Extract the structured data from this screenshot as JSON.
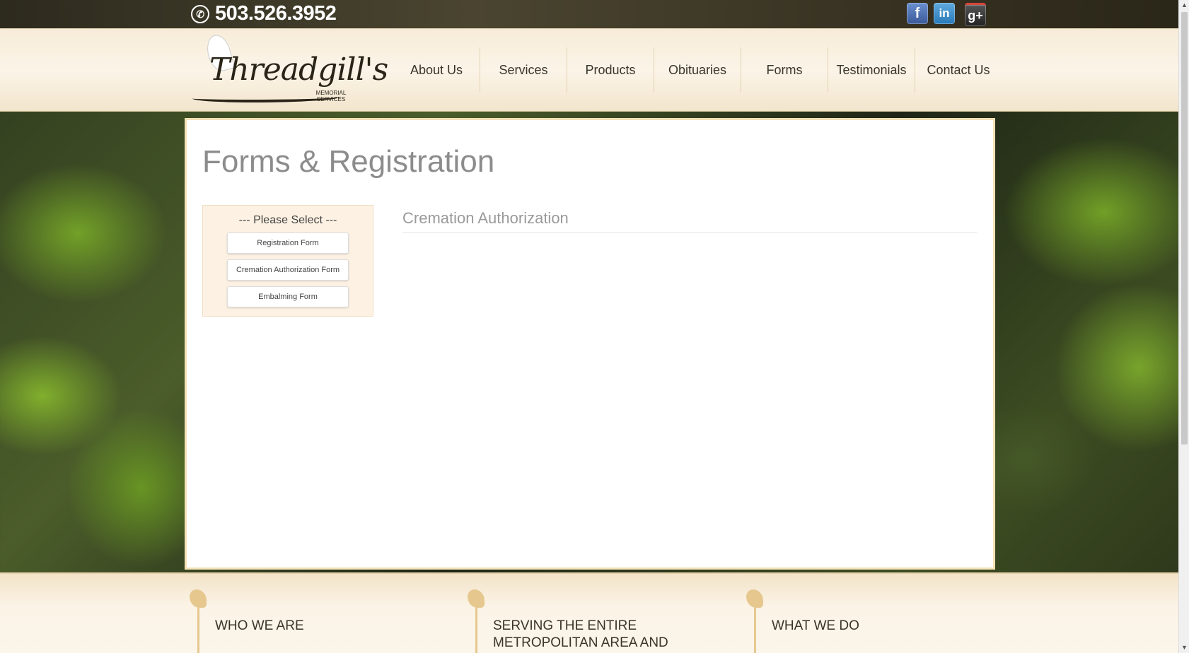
{
  "topbar": {
    "phone": "503.526.3952",
    "social": [
      "facebook-icon",
      "linkedin-icon",
      "google-plus-icon"
    ]
  },
  "header": {
    "logo_name": "Threadgill's",
    "logo_sub": "MEMORIAL SERVICES",
    "nav": [
      {
        "label": "About Us"
      },
      {
        "label": "Services"
      },
      {
        "label": "Products"
      },
      {
        "label": "Obituaries"
      },
      {
        "label": "Forms"
      },
      {
        "label": "Testimonials"
      },
      {
        "label": "Contact Us"
      }
    ]
  },
  "main": {
    "page_title": "Forms & Registration",
    "select_title": "--- Please Select ---",
    "forms": [
      {
        "label": "Registration Form"
      },
      {
        "label": "Cremation Authorization Form"
      },
      {
        "label": "Embalming Form"
      }
    ],
    "section_title": "Cremation Authorization"
  },
  "footer": {
    "columns": [
      {
        "text": "WHO WE ARE"
      },
      {
        "text": "SERVING THE ENTIRE METROPOLITAN AREA AND MORE!"
      },
      {
        "text": "WHAT WE DO"
      }
    ]
  },
  "colors": {
    "header_bg": "#f7ecd9",
    "content_border": "#f3e2b8",
    "title_gray": "#8c8c8c",
    "footer_accent": "#e6c88f"
  }
}
